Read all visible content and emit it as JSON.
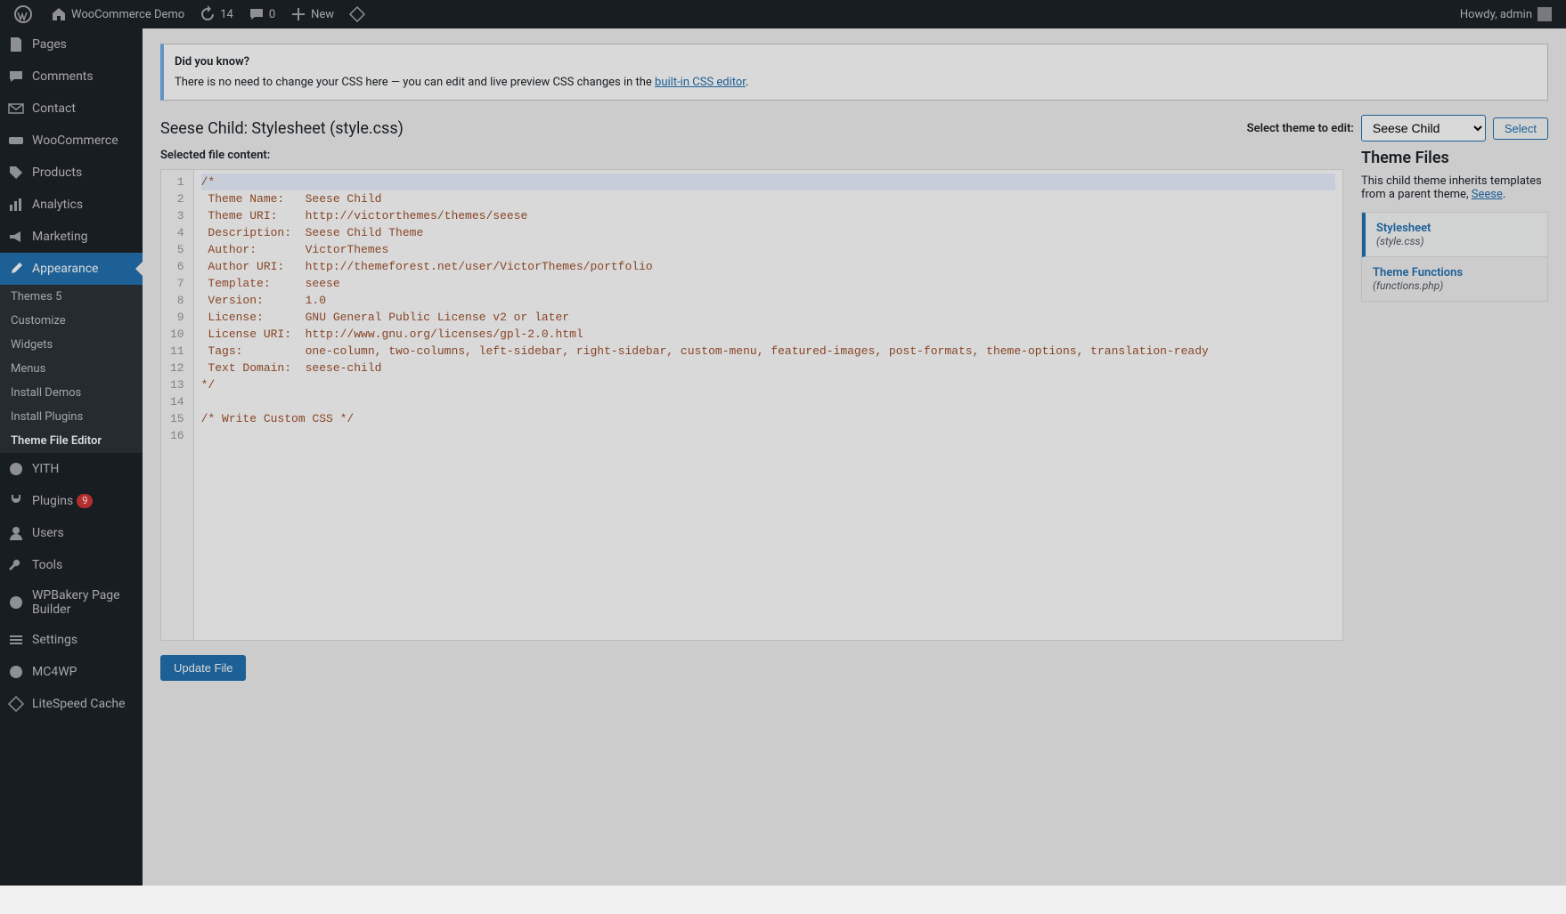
{
  "adminbar": {
    "site_name": "WooCommerce Demo",
    "updates_count": "14",
    "comments_count": "0",
    "new_label": "New",
    "howdy": "Howdy, admin"
  },
  "menu": {
    "pages": "Pages",
    "comments": "Comments",
    "contact": "Contact",
    "woocommerce": "WooCommerce",
    "products": "Products",
    "analytics": "Analytics",
    "marketing": "Marketing",
    "appearance": "Appearance",
    "yith": "YITH",
    "plugins": "Plugins",
    "plugins_badge": "9",
    "users": "Users",
    "tools": "Tools",
    "wpbakery": "WPBakery Page Builder",
    "settings": "Settings",
    "mc4wp": "MC4WP",
    "litespeed": "LiteSpeed Cache"
  },
  "submenu": {
    "themes": "Themes",
    "themes_badge": "5",
    "customize": "Customize",
    "widgets": "Widgets",
    "menus": "Menus",
    "install_demos": "Install Demos",
    "install_plugins": "Install Plugins",
    "theme_file_editor": "Theme File Editor"
  },
  "notice": {
    "heading": "Did you know?",
    "text_before": "There is no need to change your CSS here — you can edit and live preview CSS changes in the ",
    "link": "built-in CSS editor",
    "text_after": "."
  },
  "heading": "Seese Child: Stylesheet (style.css)",
  "theme_select": {
    "label": "Select theme to edit:",
    "value": "Seese Child",
    "button": "Select"
  },
  "selected_label": "Selected file content:",
  "code_lines": [
    "/*",
    " Theme Name:   Seese Child",
    " Theme URI:    http://victorthemes/themes/seese",
    " Description:  Seese Child Theme",
    " Author:       VictorThemes",
    " Author URI:   http://themeforest.net/user/VictorThemes/portfolio",
    " Template:     seese",
    " Version:      1.0",
    " License:      GNU General Public License v2 or later",
    " License URI:  http://www.gnu.org/licenses/gpl-2.0.html",
    " Tags:         one-column, two-columns, left-sidebar, right-sidebar, custom-menu, featured-images, post-formats, theme-options, translation-ready",
    " Text Domain:  seese-child",
    "*/",
    "",
    "/* Write Custom CSS */",
    ""
  ],
  "theme_files": {
    "heading": "Theme Files",
    "desc_before": "This child theme inherits templates from a parent theme, ",
    "parent": "Seese",
    "desc_after": ".",
    "files": [
      {
        "name": "Stylesheet",
        "file": "(style.css)",
        "active": true
      },
      {
        "name": "Theme Functions",
        "file": "(functions.php)",
        "active": false
      }
    ]
  },
  "update_button": "Update File"
}
